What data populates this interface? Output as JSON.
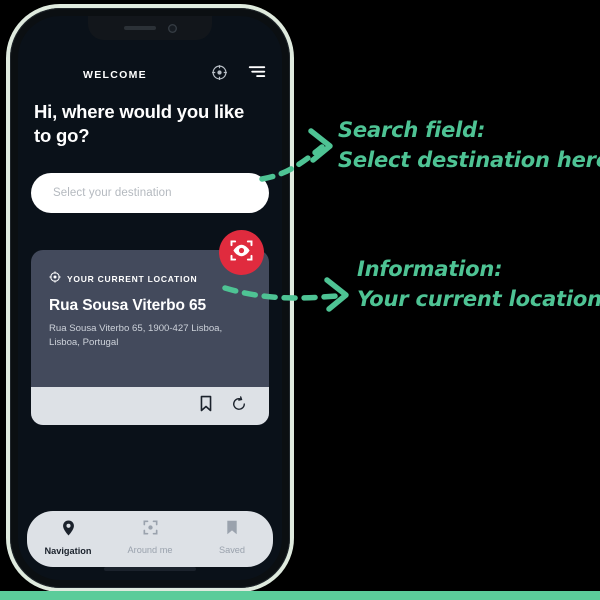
{
  "app": {
    "header": {
      "title": "WELCOME",
      "target_icon": "target-crosshair-icon",
      "menu_icon": "hamburger-menu-icon"
    },
    "greeting": "Hi, where would you like to go?",
    "search": {
      "placeholder": "Select your destination",
      "value": ""
    },
    "ar_button": {
      "icon": "eye-scan-icon",
      "color": "#e02b3e"
    },
    "location_card": {
      "label": "YOUR CURRENT LOCATION",
      "label_icon": "target-crosshair-icon",
      "title": "Rua Sousa Viterbo 65",
      "address": "Rua Sousa Viterbo 65, 1900-427 Lisboa, Lisboa, Portugal",
      "actions": [
        {
          "name": "bookmark-icon",
          "label": "Bookmark"
        },
        {
          "name": "refresh-icon",
          "label": "Refresh"
        }
      ]
    },
    "tabs": [
      {
        "label": "Navigation",
        "icon": "map-pin-icon",
        "active": true
      },
      {
        "label": "Around me",
        "icon": "scan-frame-icon",
        "active": false
      },
      {
        "label": "Saved",
        "icon": "bookmark-icon",
        "active": false
      }
    ]
  },
  "annotations": [
    {
      "id": "search-annotation",
      "line1": "Search field:",
      "line2": "Select destination here"
    },
    {
      "id": "info-annotation",
      "line1": "Information:",
      "line2": "Your current location"
    }
  ],
  "colors": {
    "accent_green": "#4ec394",
    "screen_bg": "#0a1119",
    "card_bg": "#434a5c",
    "fab_red": "#e02b3e",
    "light_panel": "#dde1e6",
    "frame_glow": "#dfeade",
    "bottom_bar": "#5bcc9a"
  }
}
